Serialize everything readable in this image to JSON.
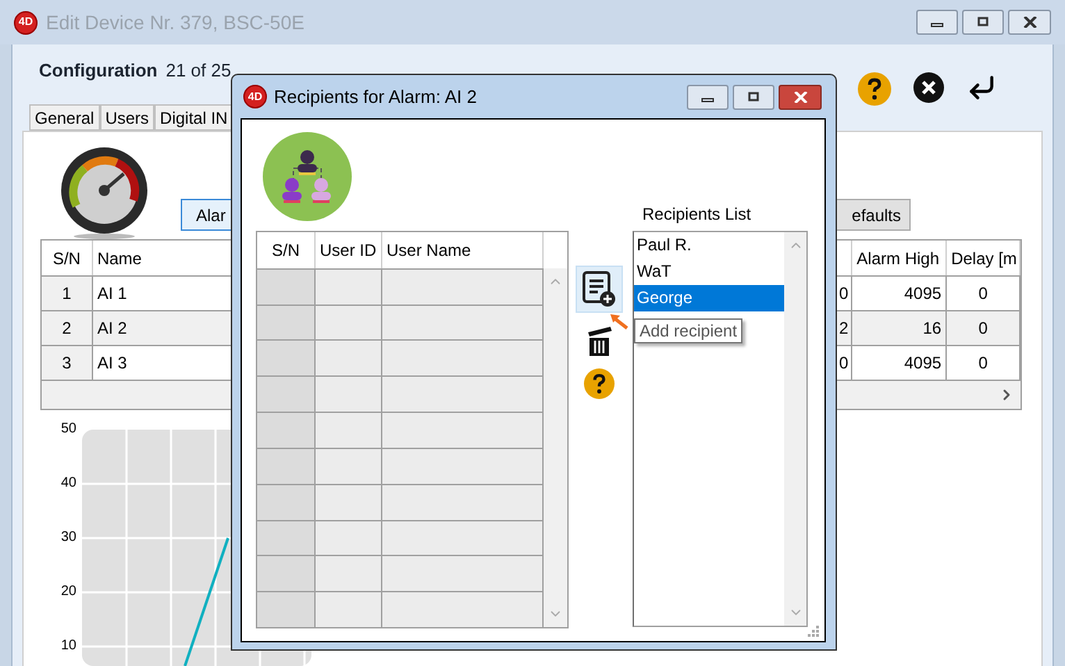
{
  "main_window": {
    "logo": "4D",
    "title": "Edit Device Nr. 379, BSC-50E"
  },
  "header": {
    "label": "Configuration",
    "counter": "21 of 25"
  },
  "tabs": [
    {
      "label": "General",
      "selected": false
    },
    {
      "label": "Users",
      "selected": false
    },
    {
      "label": "Digital IN",
      "selected": false
    }
  ],
  "buttons": [
    "Alar",
    "efaults"
  ],
  "table": {
    "columns": [
      "S/N",
      "Name",
      "Alarm High",
      "Delay [m"
    ],
    "rows": [
      {
        "sn": "1",
        "name": "AI 1",
        "column_3": "0",
        "alarm_high": "4095",
        "delay": "0"
      },
      {
        "sn": "2",
        "name": "AI 2",
        "column_3": "2",
        "alarm_high": "16",
        "delay": "0"
      },
      {
        "sn": "3",
        "name": "AI 3",
        "column_3": "0",
        "alarm_high": "4095",
        "delay": "0"
      }
    ]
  },
  "chart": {
    "y_labels": [
      "50",
      "40",
      "30",
      "20",
      "10"
    ]
  },
  "dialog": {
    "logo": "4D",
    "title": "Recipients for Alarm: AI 2",
    "users_table": {
      "columns": [
        "S/N",
        "User ID",
        "User Name"
      ]
    },
    "recipients": {
      "label": "Recipients List",
      "items": [
        {
          "name": "Paul R.",
          "selected": false
        },
        {
          "name": "WaT",
          "selected": false
        },
        {
          "name": "George",
          "selected": true
        }
      ]
    },
    "tooltip": "Add recipient"
  }
}
